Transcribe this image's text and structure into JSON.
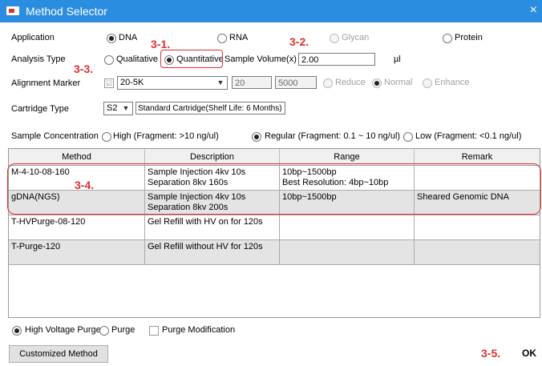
{
  "window": {
    "title": "Method Selector",
    "close_glyph": "×",
    "icon": "app-icon"
  },
  "application": {
    "label": "Application",
    "options": [
      {
        "label": "DNA",
        "checked": true,
        "disabled": false
      },
      {
        "label": "RNA",
        "checked": false,
        "disabled": false
      },
      {
        "label": "Glycan",
        "checked": false,
        "disabled": true
      },
      {
        "label": "Protein",
        "checked": false,
        "disabled": false
      }
    ]
  },
  "analysis_type": {
    "label": "Analysis Type",
    "options": [
      {
        "label": "Qualitative",
        "checked": false
      },
      {
        "label": "Quantitative",
        "checked": true
      }
    ],
    "sample_volume_label": "Sample Volume(x) :",
    "sample_volume_value": "2.00",
    "sample_volume_unit": "µl"
  },
  "alignment_marker": {
    "label": "Alignment Marker",
    "checkbox_glyph": "☑",
    "selected": "20-5K",
    "low": "20",
    "high": "5000",
    "modes": [
      {
        "label": "Reduce",
        "checked": false
      },
      {
        "label": "Normal",
        "checked": true
      },
      {
        "label": "Enhance",
        "checked": false
      }
    ]
  },
  "cartridge": {
    "label": "Cartridge Type",
    "selected": "S2",
    "description": "Standard Cartridge(Shelf Life: 6 Months)"
  },
  "sample_concentration": {
    "label": "Sample Concentration",
    "options": [
      {
        "label": "High (Fragment: >10 ng/ul)",
        "checked": false
      },
      {
        "label": "Regular (Fragment: 0.1 ~ 10 ng/ul)",
        "checked": true
      },
      {
        "label": "Low (Fragment: <0.1 ng/ul)",
        "checked": false
      }
    ]
  },
  "table": {
    "columns": [
      "Method",
      "Description",
      "Range",
      "Remark"
    ],
    "rows": [
      {
        "method": "M-4-10-08-160",
        "desc1": "Sample Injection 4kv 10s",
        "desc2": "Separation 8kv 160s",
        "range1": "10bp~1500bp",
        "range2": "Best Resolution: 4bp~10bp",
        "remark": ""
      },
      {
        "method": "gDNA(NGS)",
        "desc1": "Sample Injection 4kv 10s",
        "desc2": "Separation 8kv 200s",
        "range1": "10bp~1500bp",
        "range2": "",
        "remark": "Sheared Genomic DNA"
      },
      {
        "method": "T-HVPurge-08-120",
        "desc1": "Gel Refill with HV on for 120s",
        "desc2": "",
        "range1": "",
        "range2": "",
        "remark": ""
      },
      {
        "method": "T-Purge-120",
        "desc1": "Gel Refill without HV for 120s",
        "desc2": "",
        "range1": "",
        "range2": "",
        "remark": ""
      }
    ]
  },
  "purge": {
    "options": [
      {
        "label": "High Voltage Purge",
        "checked": true
      },
      {
        "label": "Purge",
        "checked": false
      }
    ],
    "modification_label": "Purge Modification",
    "modification_checked": false
  },
  "buttons": {
    "customized": "Customized Method",
    "ok": "OK"
  },
  "annotations": {
    "a1": "3-1.",
    "a2": "3-2.",
    "a3": "3-3.",
    "a4": "3-4.",
    "a5": "3-5."
  },
  "colors": {
    "titlebar": "#2b8de0",
    "annotation": "#e03030",
    "row_alt": "#e4e4e4"
  }
}
